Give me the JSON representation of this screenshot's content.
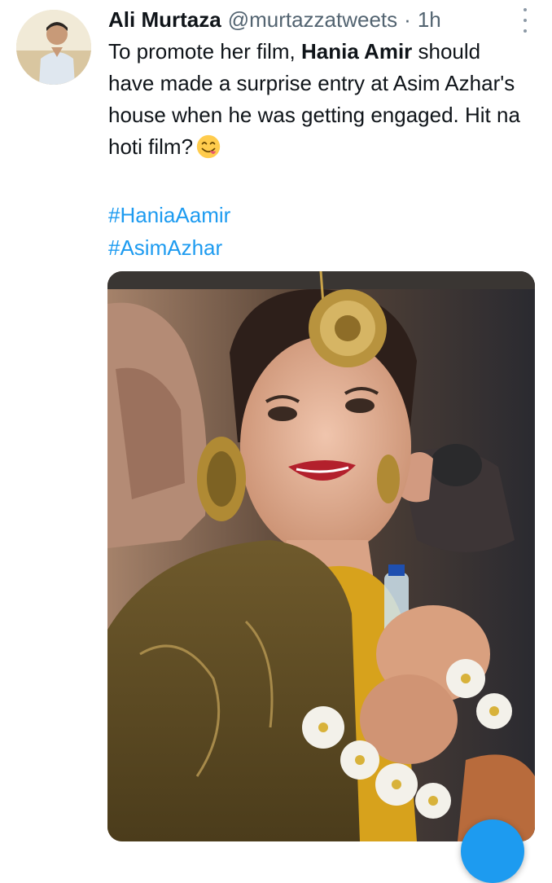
{
  "tweet": {
    "author_name": "Ali Murtaza",
    "author_handle": "@murtazzatweets",
    "separator": "·",
    "time": "1h",
    "text_part1": "To promote her film, ",
    "text_bold": "Hania Amir",
    "text_part2": " should have made a surprise entry at Asim Azhar's house when he was getting engaged. Hit na hoti film?",
    "emoji": "face-savoring-food",
    "hashtags": [
      "#HaniaAamir",
      "#AsimAzhar"
    ]
  },
  "colors": {
    "link": "#1d9bf0",
    "secondary_text": "#536471",
    "primary_text": "#0f1419",
    "fab": "#1d9bf0"
  },
  "icons": {
    "more": "more-vertical-icon",
    "compose": "compose-tweet-icon"
  }
}
